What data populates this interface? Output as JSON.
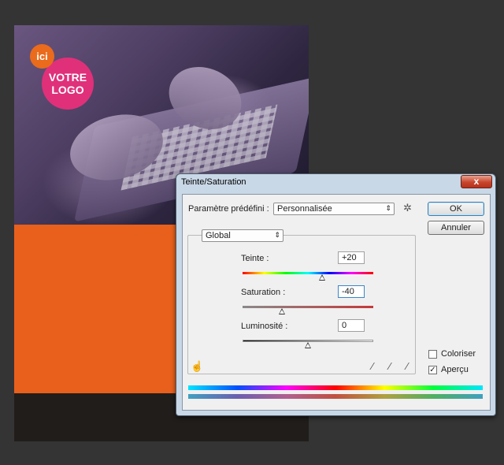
{
  "artwork": {
    "ici_badge": "ici",
    "logo_line1": "VOTRE",
    "logo_line2": "LOGO"
  },
  "dialog": {
    "title": "Teinte/Saturation",
    "close_symbol": "x",
    "preset_label": "Paramètre prédéfini :",
    "preset_value": "Personnalisée",
    "ok_label": "OK",
    "cancel_label": "Annuler",
    "channel_value": "Global",
    "hue_label": "Teinte :",
    "hue_value": "+20",
    "saturation_label": "Saturation :",
    "saturation_value": "-40",
    "lightness_label": "Luminosité :",
    "lightness_value": "0",
    "colorize_label": "Coloriser",
    "preview_label": "Aperçu",
    "preview_checked": true,
    "colorize_checked": false,
    "slider_positions": {
      "hue": 0.61,
      "saturation": 0.3,
      "lightness": 0.5
    }
  },
  "icons": {
    "gear": "gear-icon",
    "hand": "hand-target-icon",
    "eyedroppers": [
      "eyedropper-icon",
      "eyedropper-plus-icon",
      "eyedropper-minus-icon"
    ]
  },
  "colors": {
    "orange_block": "#e8601c",
    "logo_pink": "#e0307a",
    "badge_orange": "#ea6b1b"
  }
}
